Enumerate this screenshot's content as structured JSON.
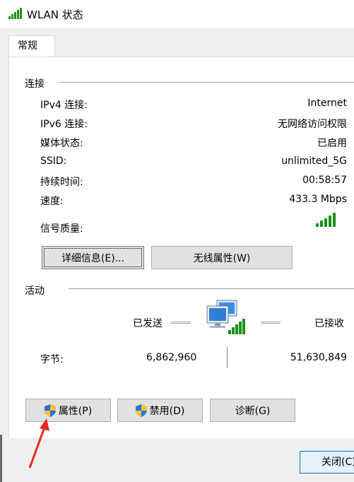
{
  "window": {
    "title": "WLAN 状态",
    "title_icon": "wifi-signal-icon"
  },
  "tabs": [
    {
      "label": "常规"
    }
  ],
  "connection": {
    "section_title": "连接",
    "rows": [
      {
        "label": "IPv4 连接:",
        "value": "Internet"
      },
      {
        "label": "IPv6 连接:",
        "value": "无网络访问权限"
      },
      {
        "label": "媒体状态:",
        "value": "已启用"
      },
      {
        "label": "SSID:",
        "value": "unlimited_5G"
      },
      {
        "label": "持续时间:",
        "value": "00:58:57"
      },
      {
        "label": "速度:",
        "value": "433.3 Mbps"
      }
    ],
    "signal_label": "信号质量:",
    "signal_bars": 5,
    "details_button": "详细信息(E)...",
    "wireless_props_button": "无线属性(W)"
  },
  "activity": {
    "section_title": "活动",
    "sent_label": "已发送",
    "received_label": "已接收",
    "bytes_label": "字节:",
    "bytes_sent": "6,862,960",
    "bytes_received": "51,630,849"
  },
  "actions": {
    "properties_button": "属性(P)",
    "disable_button": "禁用(D)",
    "diagnose_button": "诊断(G)"
  },
  "footer": {
    "close_button": "关闭(C)"
  },
  "colors": {
    "accent": "#0078d7",
    "signal_green": "#1d8f1d",
    "annotation_red": "#e52a1e"
  }
}
